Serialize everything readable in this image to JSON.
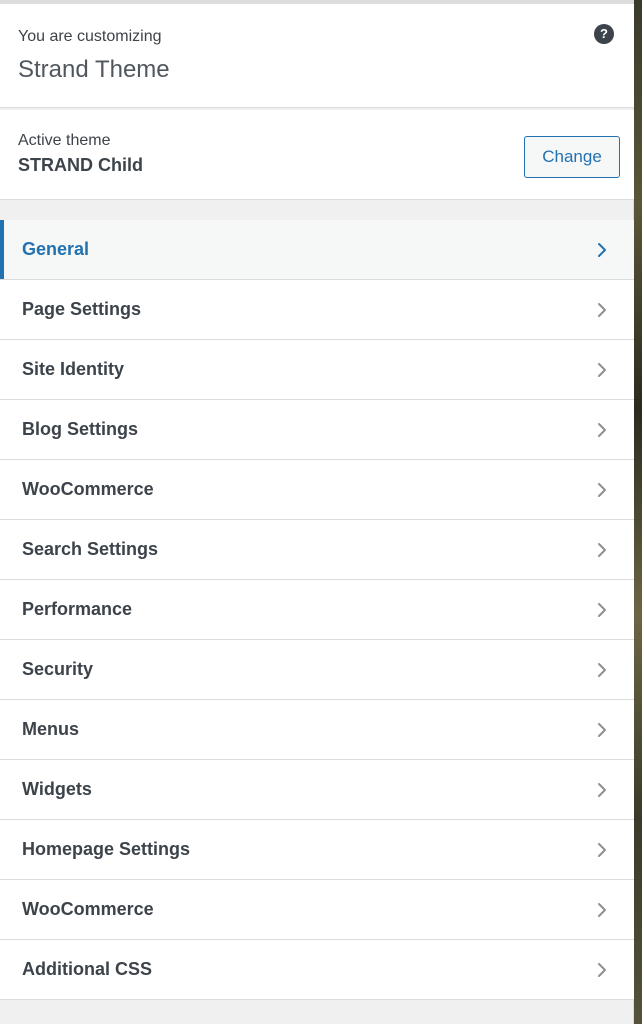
{
  "header": {
    "pre": "You are customizing",
    "title": "Strand Theme",
    "help_icon": "question-circle-icon"
  },
  "theme": {
    "label": "Active theme",
    "name": "STRAND Child",
    "change_label": "Change"
  },
  "colors": {
    "accent": "#2271b1",
    "text": "#3c434a",
    "chevron": "#8c8f94"
  },
  "menu": {
    "items": [
      {
        "label": "General",
        "active": true
      },
      {
        "label": "Page Settings"
      },
      {
        "label": "Site Identity"
      },
      {
        "label": "Blog Settings"
      },
      {
        "label": "WooCommerce"
      },
      {
        "label": "Search Settings"
      },
      {
        "label": "Performance"
      },
      {
        "label": "Security"
      },
      {
        "label": "Menus"
      },
      {
        "label": "Widgets"
      },
      {
        "label": "Homepage Settings"
      },
      {
        "label": "WooCommerce"
      },
      {
        "label": "Additional CSS"
      }
    ]
  }
}
